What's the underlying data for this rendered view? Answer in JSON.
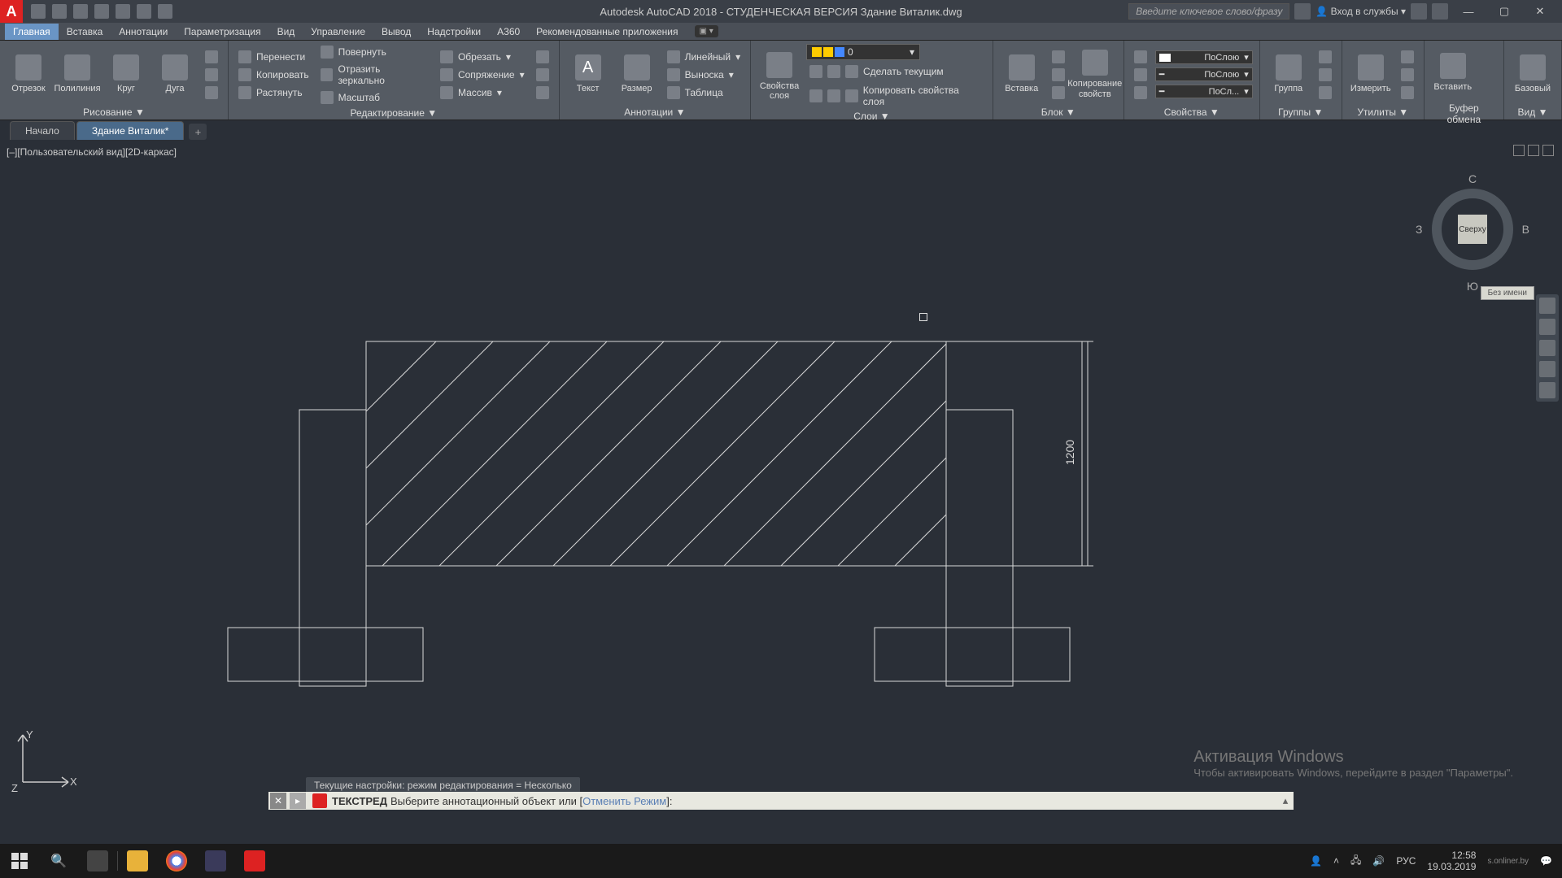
{
  "titlebar": {
    "app_letter": "A",
    "title": "Autodesk AutoCAD 2018 - СТУДЕНЧЕСКАЯ ВЕРСИЯ   Здание Виталик.dwg",
    "search_placeholder": "Введите ключевое слово/фразу",
    "signin": "Вход в службы",
    "min": "—",
    "max": "▢",
    "close": "✕"
  },
  "menubar": {
    "items": [
      "Главная",
      "Вставка",
      "Аннотации",
      "Параметризация",
      "Вид",
      "Управление",
      "Вывод",
      "Надстройки",
      "A360",
      "Рекомендованные приложения"
    ],
    "active_index": 0
  },
  "ribbon": {
    "draw": {
      "title": "Рисование ▼",
      "btns": [
        "Отрезок",
        "Полилиния",
        "Круг",
        "Дуга"
      ]
    },
    "modify": {
      "title": "Редактирование ▼",
      "small": [
        "Перенести",
        "Повернуть",
        "Обрезать",
        "Копировать",
        "Отразить зеркально",
        "Сопряжение",
        "Растянуть",
        "Масштаб",
        "Массив"
      ]
    },
    "annot": {
      "title": "Аннотации ▼",
      "big": [
        "Текст",
        "Размер"
      ],
      "small": [
        "Линейный",
        "Выноска",
        "Таблица"
      ]
    },
    "layers": {
      "title": "Слои ▼",
      "big": "Свойства слоя",
      "small": [
        "Сделать текущим",
        "Копировать свойства слоя"
      ],
      "dd_value": "0"
    },
    "block": {
      "title": "Блок ▼",
      "big": [
        "Вставка",
        "Копирование свойств"
      ]
    },
    "props": {
      "title": "Свойства ▼",
      "dd": [
        "ПоСлою",
        "ПоСлою",
        "ПоСл..."
      ]
    },
    "groups": {
      "title": "Группы ▼",
      "big": "Группа"
    },
    "utils": {
      "title": "Утилиты ▼",
      "big": "Измерить"
    },
    "clip": {
      "title": "Буфер обмена",
      "big": "Вставить"
    },
    "view": {
      "title": "Вид ▼",
      "big": "Базовый"
    }
  },
  "doctabs": {
    "start": "Начало",
    "active": "Здание Виталик*",
    "plus": "+"
  },
  "viewport": {
    "label": "[–][Пользовательский вид][2D-каркас]",
    "cube": "Сверху",
    "n": "С",
    "s": "Ю",
    "e": "В",
    "w": "З",
    "noname": "Без имени"
  },
  "ucs": {
    "x": "X",
    "y": "Y",
    "z": "Z"
  },
  "drawing": {
    "dim1": "1200"
  },
  "watermark": {
    "title": "Активация Windows",
    "sub": "Чтобы активировать Windows, перейдите в раздел \"Параметры\"."
  },
  "cmd": {
    "history": "Текущие настройки: режим редактирования = Несколько",
    "name": "ТЕКСТРЕД",
    "prompt": "Выберите аннотационный объект или [",
    "opt1": "Отменить",
    "opt2": "Режим",
    "end": "]:"
  },
  "taskbar": {
    "lang": "РУС",
    "time": "12:58",
    "date": "19.03.2019",
    "corner": "s.onliner.by"
  }
}
